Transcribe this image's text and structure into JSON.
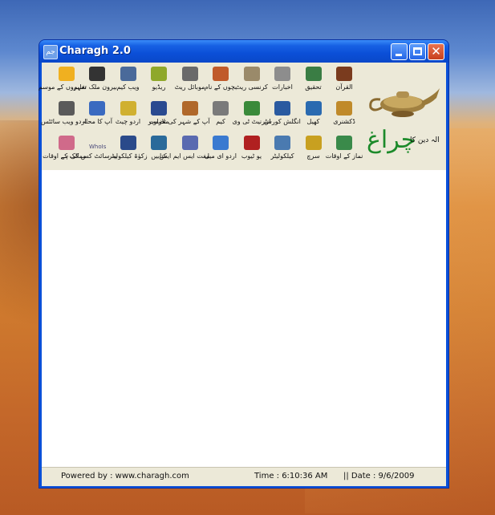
{
  "window": {
    "title": "Charagh 2.0",
    "icon_text": "جم"
  },
  "title_buttons": {
    "close_glyph": "✕"
  },
  "logo": {
    "big_text": "چراغ",
    "small_text": "الہ دین کا"
  },
  "toolbar": {
    "row1": [
      {
        "label": "القرآن",
        "icon": "quran-icon",
        "color": "#7a3b1e"
      },
      {
        "label": "تحقیق",
        "icon": "research-icon",
        "color": "#3a7d44"
      },
      {
        "label": "اخبارات",
        "icon": "newspaper-icon",
        "color": "#8d8d8d"
      },
      {
        "label": "کرنسی ریٹ",
        "icon": "currency-icon",
        "color": "#9a8a6a"
      },
      {
        "label": "بچوں کے نام",
        "icon": "kids-names-icon",
        "color": "#c05a2a"
      },
      {
        "label": "موبائل ریٹ",
        "icon": "mobile-rate-icon",
        "color": "#6a6a6a"
      },
      {
        "label": "ریڈیو",
        "icon": "radio-icon",
        "color": "#8fa82a"
      },
      {
        "label": "ویب کیم",
        "icon": "webcam-icon",
        "color": "#4a6a9a"
      },
      {
        "label": "بیرون ملک تعلیم",
        "icon": "study-abroad-icon",
        "color": "#333333"
      },
      {
        "label": "شہروں کے موسم",
        "icon": "weather-icon",
        "color": "#f0b020"
      }
    ],
    "row2": [
      {
        "label": "ڈکشنری",
        "icon": "dictionary-icon",
        "color": "#c08a2a"
      },
      {
        "label": "کھیل",
        "icon": "games-icon",
        "color": "#2a6ab0"
      },
      {
        "label": "انگلش کورس",
        "icon": "english-course-icon",
        "color": "#2a5aa0"
      },
      {
        "label": "انٹرنیٹ ٹی وی",
        "icon": "internet-tv-icon",
        "color": "#3a8a3a"
      },
      {
        "label": "کیم",
        "icon": "car-icon",
        "color": "#7a7a7a"
      },
      {
        "label": "آپ کے شہر کی تصاویر",
        "icon": "city-photos-icon",
        "color": "#b0682a"
      },
      {
        "label": "ملازمت",
        "icon": "jobs-icon",
        "color": "#2a4a90"
      },
      {
        "label": "اردو چیٹ",
        "icon": "urdu-chat-icon",
        "color": "#d0b030"
      },
      {
        "label": "آپ کا محلہ",
        "icon": "neighborhood-icon",
        "color": "#3a6ac0"
      },
      {
        "label": "اردو ویب سائٹس",
        "icon": "urdu-websites-icon",
        "color": "#5a5a5a"
      }
    ],
    "row3": [
      {
        "label": "نماز کے اوقات",
        "icon": "prayer-times-icon",
        "color": "#3a8a4a"
      },
      {
        "label": "سرچ",
        "icon": "search-icon",
        "color": "#c8a020"
      },
      {
        "label": "کیلکولیٹر",
        "icon": "calculator-icon",
        "color": "#4a7ab0"
      },
      {
        "label": "یو ٹیوب",
        "icon": "youtube-icon",
        "color": "#b02020"
      },
      {
        "label": "اردو ای میل",
        "icon": "email-icon",
        "color": "#3a7ad0"
      },
      {
        "label": "مفت ایس ایم ایس",
        "icon": "sms-icon",
        "color": "#5a6ab0"
      },
      {
        "label": "کتابیں",
        "icon": "books-icon",
        "color": "#2a6a9a"
      },
      {
        "label": "زکوٰۃ کیلکولیٹر",
        "icon": "zakat-icon",
        "color": "#2a4a8a"
      },
      {
        "label": "یہ سائٹ کس کی ہے",
        "icon": "whois-icon",
        "color": "#4a4a7a",
        "text": "WhoIs"
      },
      {
        "label": "ممالک کے اوقات",
        "icon": "world-time-icon",
        "color": "#d06a8a"
      }
    ]
  },
  "status": {
    "powered_by": "Powered by : www.charagh.com",
    "time": "Time : 6:10:36 AM",
    "date": "||  Date : 9/6/2009"
  }
}
